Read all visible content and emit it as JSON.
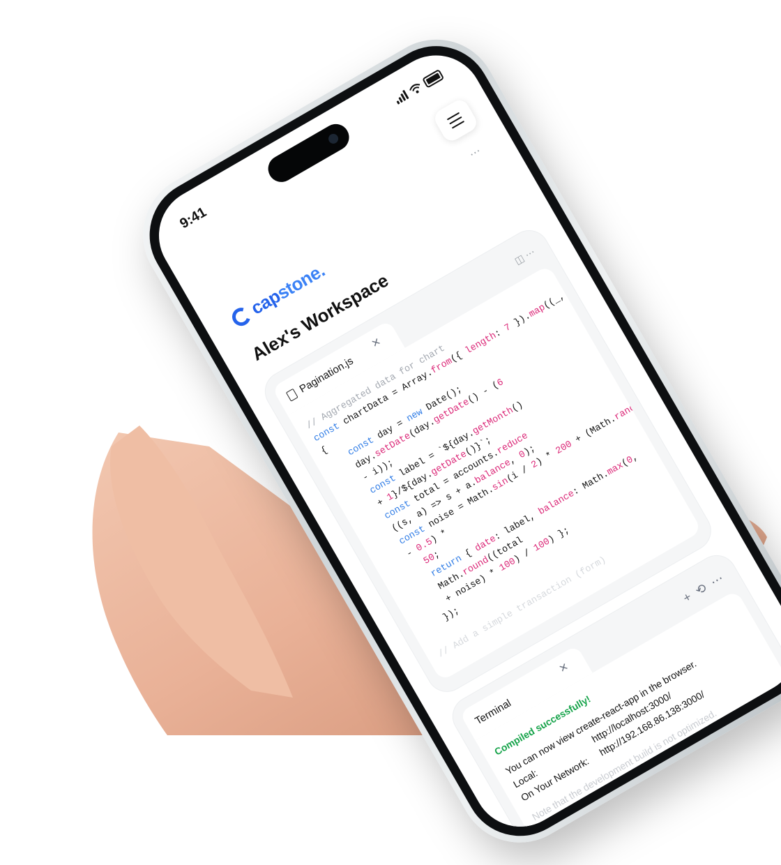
{
  "status": {
    "time": "9:41"
  },
  "brand": {
    "part1": "cap",
    "part2": "stone."
  },
  "workspace": {
    "title": "Alex's Workspace"
  },
  "editor": {
    "tab_label": "Pagination.js",
    "close_glyph": "×",
    "card_dots": "⋯",
    "split_glyph": "◫"
  },
  "terminal": {
    "tab_label": "Terminal",
    "close_glyph": "×",
    "success": "Compiled successfully!",
    "line1": "You can now view create-react-app in the browser.",
    "local_label": "Local:",
    "local_url": "http://localhost:3000/",
    "network_label": "On Your Network:",
    "network_url": "http://192.168.86.138:3000/",
    "note": "Note that the development build is not optimized.",
    "add_glyph": "+",
    "history_glyph": "⟲",
    "more_glyph": "⋯"
  },
  "menu": {
    "dots": "⋯"
  },
  "colors": {
    "brand": "#2563eb",
    "keyword": "#2f7ce6",
    "property": "#db2777",
    "success": "#16a34a"
  }
}
